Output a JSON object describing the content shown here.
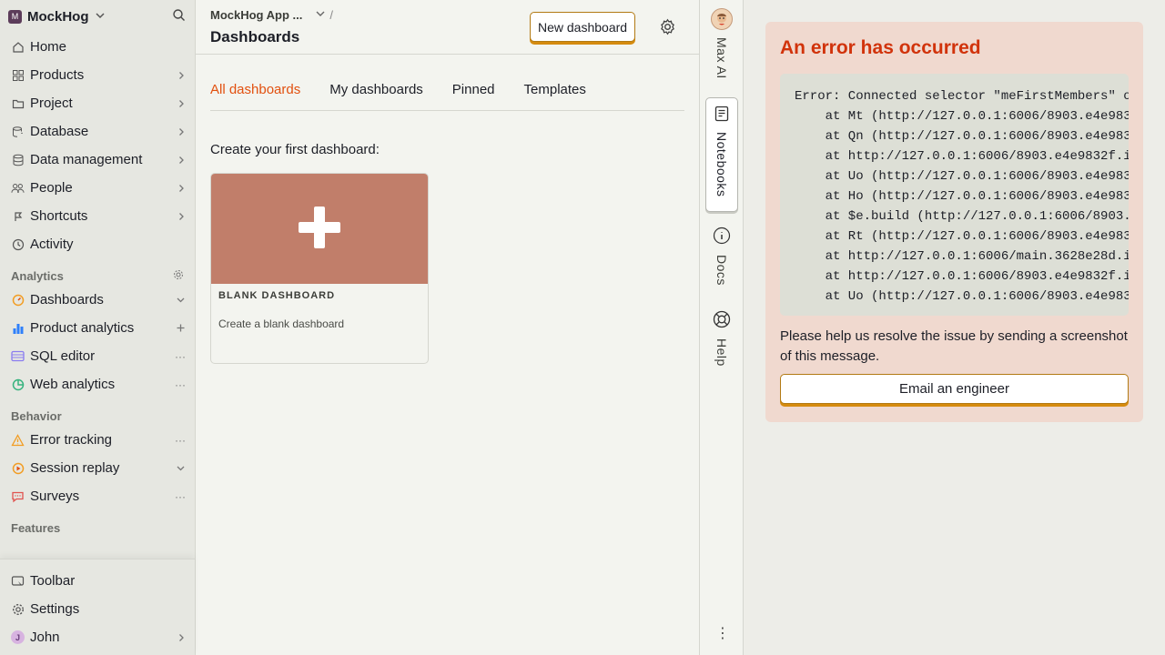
{
  "sidebar": {
    "project_badge": "M",
    "project_name": "MockHog",
    "nav": [
      {
        "label": "Home",
        "icon": "home-icon"
      },
      {
        "label": "Products",
        "icon": "grid-icon"
      },
      {
        "label": "Project",
        "icon": "folder-icon"
      },
      {
        "label": "Database",
        "icon": "database-icon"
      },
      {
        "label": "Data management",
        "icon": "data-icon"
      },
      {
        "label": "People",
        "icon": "people-icon"
      },
      {
        "label": "Shortcuts",
        "icon": "shortcut-icon"
      },
      {
        "label": "Activity",
        "icon": "clock-icon"
      }
    ],
    "analytics_header": "Analytics",
    "analytics": [
      {
        "label": "Dashboards",
        "icon": "dashboard-icon"
      },
      {
        "label": "Product analytics",
        "icon": "bar-chart-icon"
      },
      {
        "label": "SQL editor",
        "icon": "sql-icon"
      },
      {
        "label": "Web analytics",
        "icon": "pie-icon"
      }
    ],
    "behavior_header": "Behavior",
    "behavior": [
      {
        "label": "Error tracking",
        "icon": "warning-icon"
      },
      {
        "label": "Session replay",
        "icon": "replay-icon"
      },
      {
        "label": "Surveys",
        "icon": "survey-icon"
      }
    ],
    "features_header": "Features",
    "bottom": [
      {
        "label": "Toolbar",
        "icon": "toolbar-icon"
      },
      {
        "label": "Settings",
        "icon": "gear-icon"
      },
      {
        "label": "John",
        "icon": "avatar"
      }
    ],
    "user_initial": "J"
  },
  "header": {
    "breadcrumb": "MockHog App ...",
    "breadcrumb_sep": "/",
    "title": "Dashboards",
    "new_button": "New dashboard"
  },
  "tabs": [
    "All dashboards",
    "My dashboards",
    "Pinned",
    "Templates"
  ],
  "create_label": "Create your first dashboard:",
  "card": {
    "title": "BLANK DASHBOARD",
    "description": "Create a blank dashboard"
  },
  "rail": {
    "max_ai": "Max AI",
    "notebooks": "Notebooks",
    "docs": "Docs",
    "help": "Help",
    "more": "⋮"
  },
  "error": {
    "title": "An error has occurred",
    "trace": [
      "Error: Connected selector \"meFirstMembers\" o",
      "    at Mt (http://127.0.0.1:6006/8903.e4e983",
      "    at Qn (http://127.0.0.1:6006/8903.e4e983",
      "    at http://127.0.0.1:6006/8903.e4e9832f.i",
      "    at Uo (http://127.0.0.1:6006/8903.e4e983",
      "    at Ho (http://127.0.0.1:6006/8903.e4e983",
      "    at $e.build (http://127.0.0.1:6006/8903.",
      "    at Rt (http://127.0.0.1:6006/8903.e4e983",
      "    at http://127.0.0.1:6006/main.3628e28d.i",
      "    at http://127.0.0.1:6006/8903.e4e9832f.i",
      "    at Uo (http://127.0.0.1:6006/8903.e4e983"
    ],
    "help_text": "Please help us resolve the issue by sending a screenshot of this message.",
    "email_button": "Email an engineer"
  },
  "colors": {
    "accent": "#e2500f",
    "error_title": "#d1330b",
    "button_border": "#b27a14",
    "card_top": "#c17e6a"
  }
}
